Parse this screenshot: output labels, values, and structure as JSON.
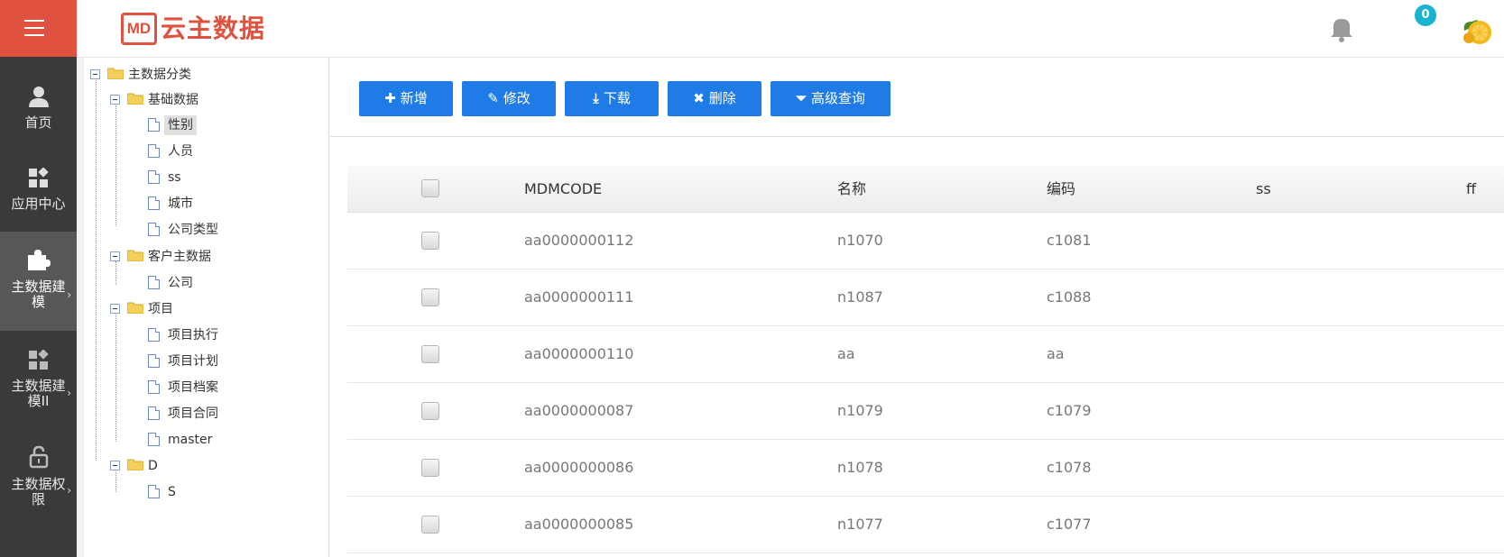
{
  "app": {
    "logo_mark": "MD",
    "logo_text": "云主数据",
    "notification_count": "0"
  },
  "sidebar": {
    "items": [
      {
        "label": "首页",
        "icon": "user-icon"
      },
      {
        "label": "应用中心",
        "icon": "apps-icon"
      },
      {
        "label_line1": "主数据建",
        "label_line2": "模",
        "icon": "puzzle-icon",
        "active": true
      },
      {
        "label_line1": "主数据建",
        "label_line2": "模II",
        "icon": "apps-icon"
      },
      {
        "label_line1": "主数据权",
        "label_line2": "限",
        "icon": "lock-icon"
      }
    ]
  },
  "tree": {
    "root": "主数据分类",
    "groups": [
      {
        "label": "基础数据",
        "children": [
          "性别",
          "人员",
          "ss",
          "城市",
          "公司类型"
        ]
      },
      {
        "label": "客户主数据",
        "children": [
          "公司"
        ]
      },
      {
        "label": "项目",
        "children": [
          "项目执行",
          "项目计划",
          "项目档案",
          "项目合同",
          "master"
        ]
      },
      {
        "label": "D",
        "children": [
          "S"
        ]
      }
    ],
    "selected": "性别"
  },
  "toolbar": {
    "add": "新增",
    "edit": "修改",
    "download": "下载",
    "delete": "删除",
    "advanced_search": "高级查询"
  },
  "table": {
    "columns": [
      "MDMCODE",
      "名称",
      "编码",
      "ss",
      "ff"
    ],
    "rows": [
      {
        "mdmcode": "aa0000000112",
        "name": "n1070",
        "code": "c1081"
      },
      {
        "mdmcode": "aa0000000111",
        "name": "n1087",
        "code": "c1088"
      },
      {
        "mdmcode": "aa0000000110",
        "name": "aa",
        "code": "aa"
      },
      {
        "mdmcode": "aa0000000087",
        "name": "n1079",
        "code": "c1079"
      },
      {
        "mdmcode": "aa0000000086",
        "name": "n1078",
        "code": "c1078"
      },
      {
        "mdmcode": "aa0000000085",
        "name": "n1077",
        "code": "c1077"
      }
    ]
  },
  "colors": {
    "accent": "#e0523f",
    "primary_button": "#1f7ce6",
    "sidebar_bg": "#3a3a3a",
    "badge": "#17b3cf"
  }
}
